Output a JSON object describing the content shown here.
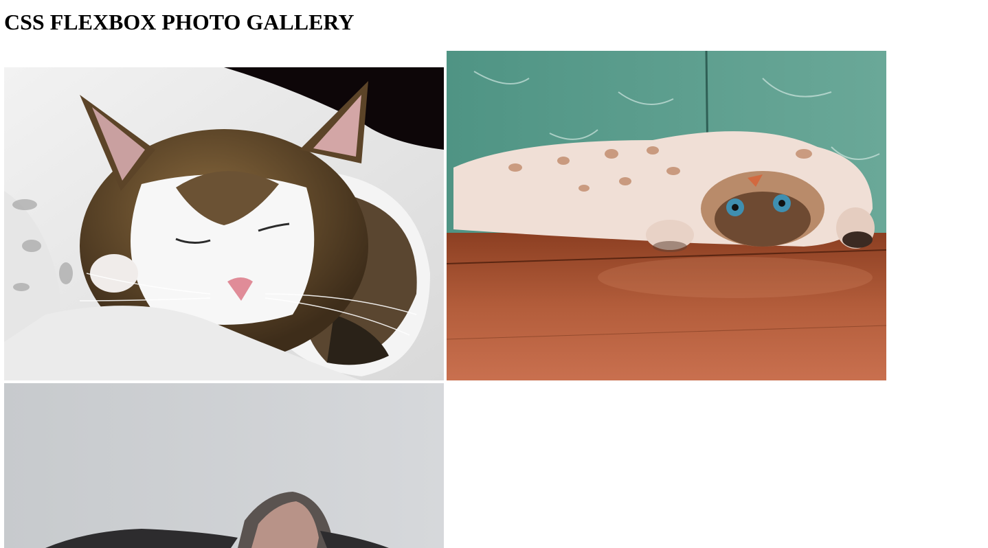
{
  "page": {
    "title": "CSS FLEXBOX PHOTO GALLERY"
  },
  "gallery": {
    "photos": [
      {
        "subject": "sleeping tabby-and-white cat on white bedding"
      },
      {
        "subject": "cream spotted cat lying upside down on wooden floor against teal wall"
      },
      {
        "subject": "grey cat against light grey wall"
      }
    ]
  },
  "colors": {
    "background": "#ffffff",
    "text": "#000000",
    "teal_wall": "#5a9e8e",
    "wood_floor": "#a5502f",
    "bedding": "#eeeeee",
    "grey_wall": "#c9ccd0"
  }
}
